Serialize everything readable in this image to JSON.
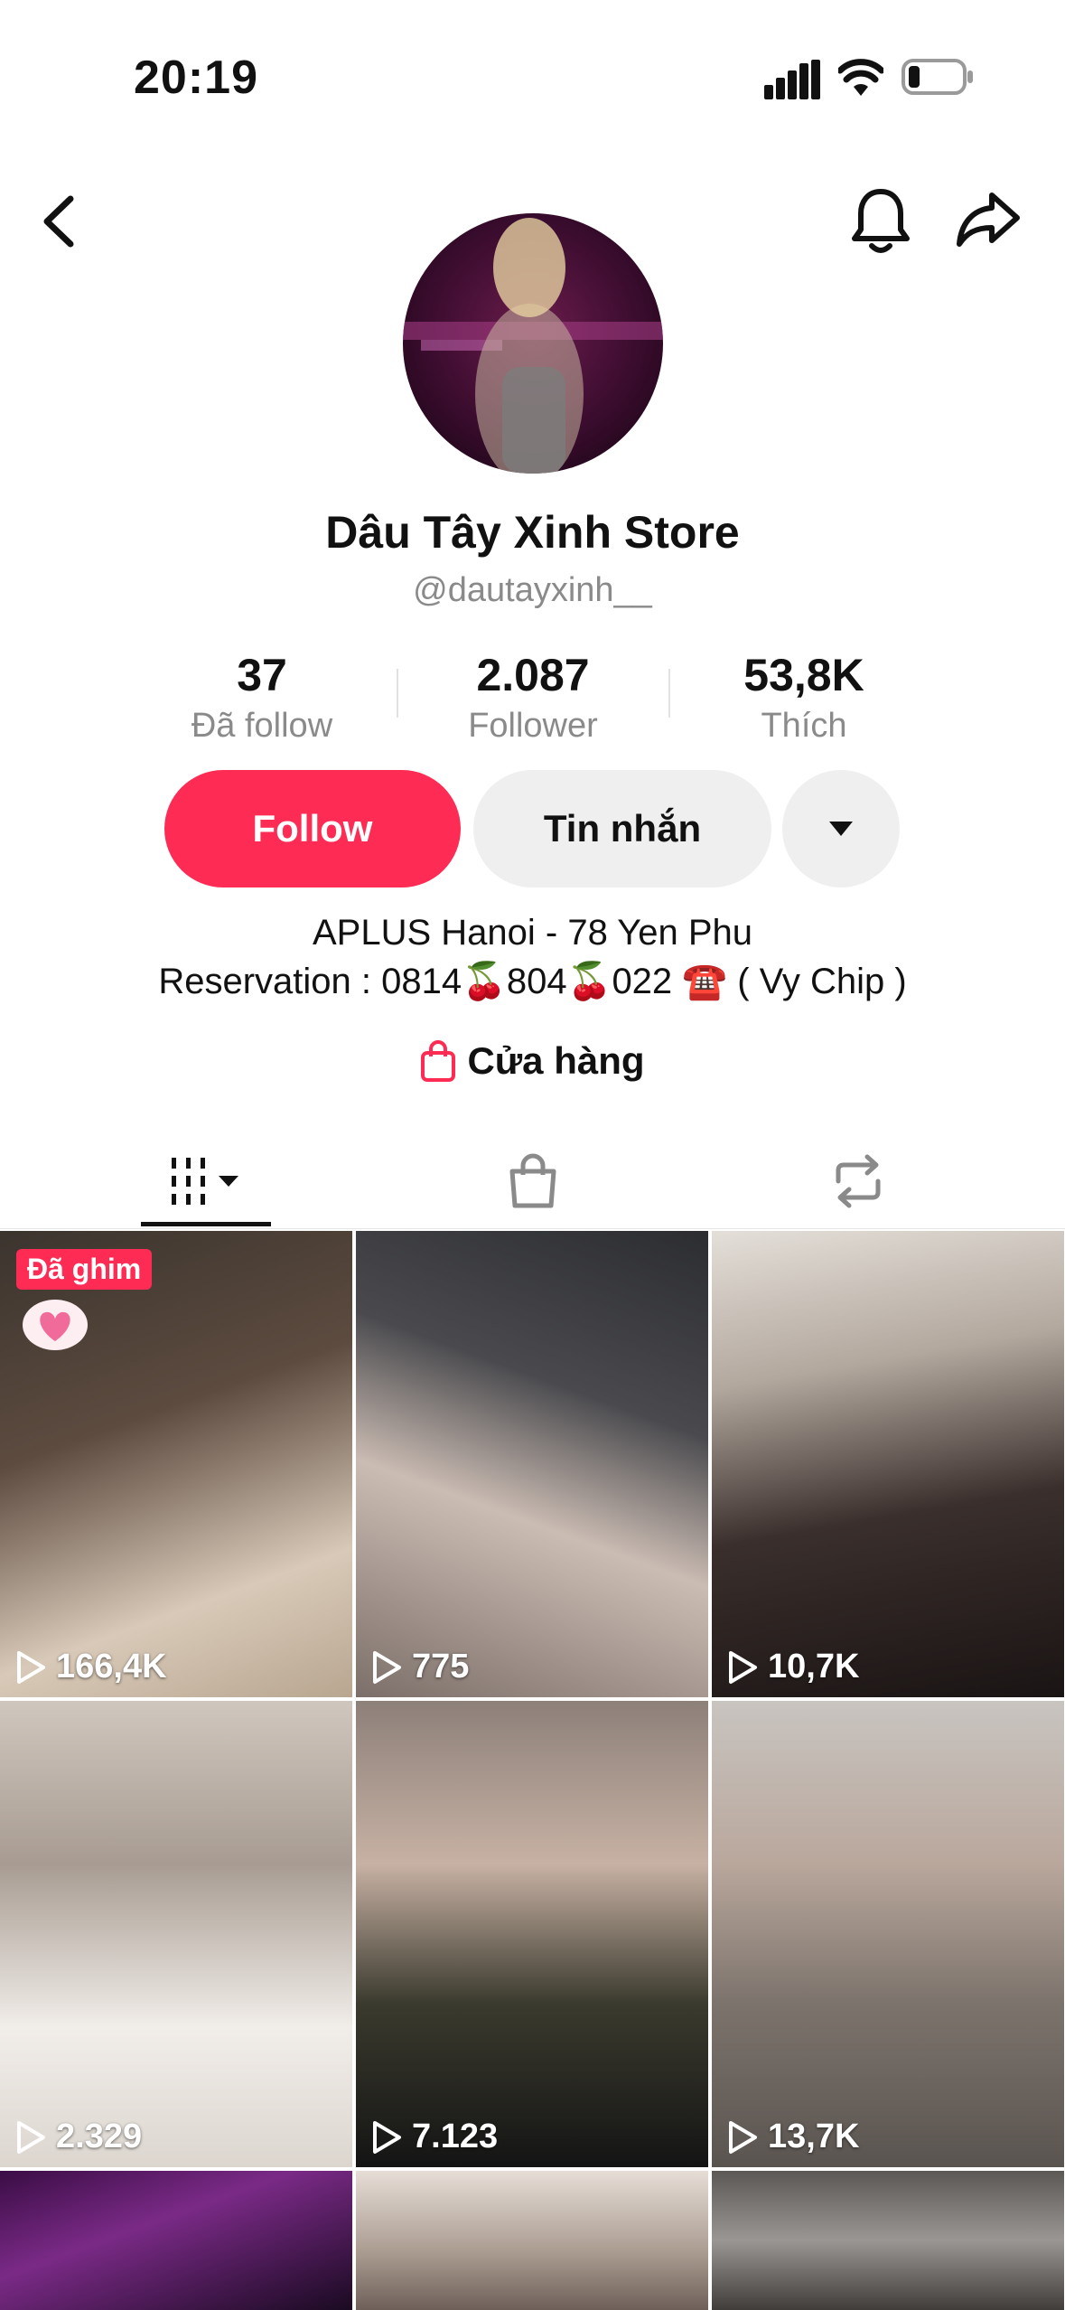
{
  "status_bar": {
    "time": "20:19"
  },
  "profile": {
    "name": "Dâu Tây Xinh Store",
    "handle": "@dautayxinh__",
    "stats": [
      {
        "value": "37",
        "label": "Đã follow"
      },
      {
        "value": "2.087",
        "label": "Follower"
      },
      {
        "value": "53,8K",
        "label": "Thích"
      }
    ],
    "buttons": {
      "follow": "Follow",
      "message": "Tin nhắn"
    },
    "bio_line1": "APLUS Hanoi - 78 Yen Phu",
    "bio_line2": "Reservation : 0814🍒804🍒022 ☎️ ( Vy Chip )",
    "shop_label": "Cửa hàng"
  },
  "videos": [
    {
      "views": "166,4K",
      "pinned_label": "Đã ghim"
    },
    {
      "views": "775"
    },
    {
      "views": "10,7K"
    },
    {
      "views": "2.329"
    },
    {
      "views": "7.123"
    },
    {
      "views": "13,7K"
    }
  ],
  "colors": {
    "accent": "#fe2c55",
    "secondary_button": "#efefef",
    "muted_text": "#8a8a8a"
  }
}
